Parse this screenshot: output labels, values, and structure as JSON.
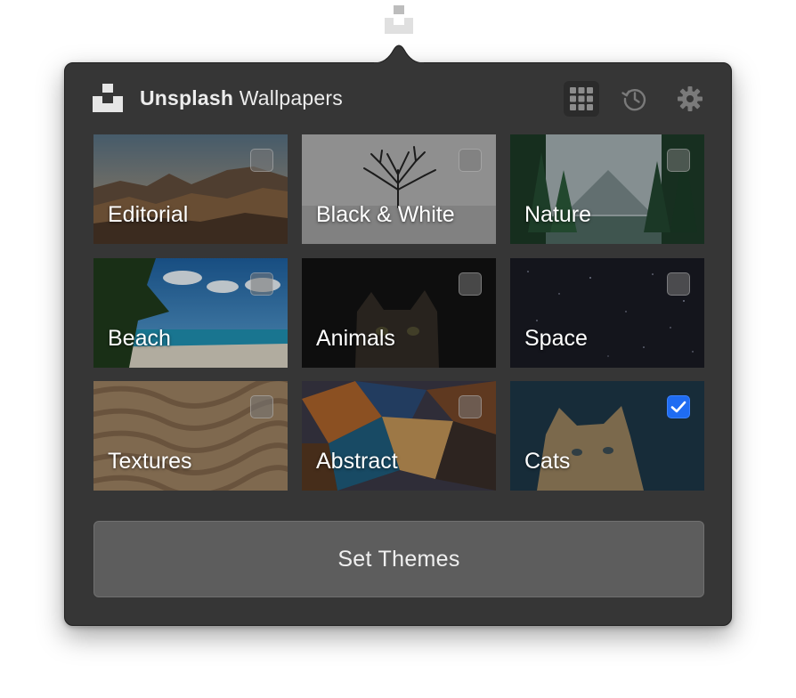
{
  "menubar": {
    "icon": "unsplash-logo-icon"
  },
  "header": {
    "brand": "Unsplash",
    "title_suffix": " Wallpapers",
    "logo_icon": "unsplash-logo-icon",
    "buttons": [
      {
        "icon": "grid-icon",
        "active": true
      },
      {
        "icon": "history-icon",
        "active": false
      },
      {
        "icon": "gear-icon",
        "active": false
      }
    ]
  },
  "themes": [
    {
      "label": "Editorial",
      "checked": false
    },
    {
      "label": "Black & White",
      "checked": false
    },
    {
      "label": "Nature",
      "checked": false
    },
    {
      "label": "Beach",
      "checked": false
    },
    {
      "label": "Animals",
      "checked": false
    },
    {
      "label": "Space",
      "checked": false
    },
    {
      "label": "Textures",
      "checked": false
    },
    {
      "label": "Abstract",
      "checked": false
    },
    {
      "label": "Cats",
      "checked": true
    }
  ],
  "footer": {
    "set_button_label": "Set Themes"
  },
  "colors": {
    "panel": "#363636",
    "button": "#5d5d5d",
    "checkbox_checked": "#1f6cf2"
  }
}
